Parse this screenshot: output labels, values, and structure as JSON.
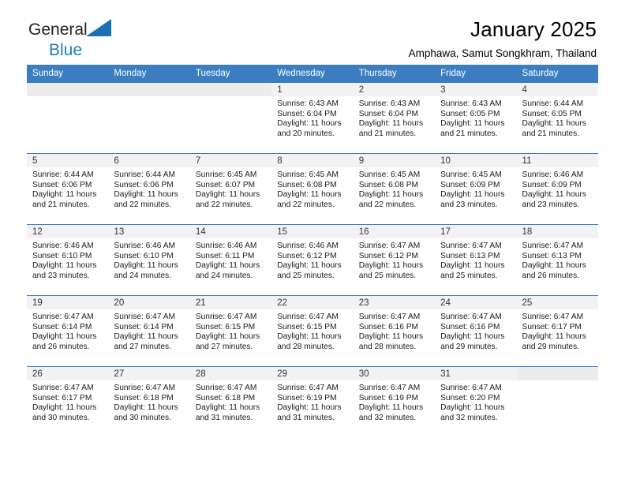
{
  "brand": {
    "name_part1": "General",
    "name_part2": "Blue",
    "accent_color": "#1a7cc6"
  },
  "header": {
    "title": "January 2025",
    "location": "Amphawa, Samut Songkhram, Thailand"
  },
  "theme": {
    "header_row_bg": "#3b7dc0",
    "daynum_band_bg": "#f2f2f2",
    "empty_band_bg": "#ececec"
  },
  "weekday_headers": [
    "Sunday",
    "Monday",
    "Tuesday",
    "Wednesday",
    "Thursday",
    "Friday",
    "Saturday"
  ],
  "weeks": [
    [
      {
        "day": "",
        "sunrise": "",
        "sunset": "",
        "daylight1": "",
        "daylight2": "",
        "empty": true
      },
      {
        "day": "",
        "sunrise": "",
        "sunset": "",
        "daylight1": "",
        "daylight2": "",
        "empty": true
      },
      {
        "day": "",
        "sunrise": "",
        "sunset": "",
        "daylight1": "",
        "daylight2": "",
        "empty": true
      },
      {
        "day": "1",
        "sunrise": "Sunrise: 6:43 AM",
        "sunset": "Sunset: 6:04 PM",
        "daylight1": "Daylight: 11 hours",
        "daylight2": "and 20 minutes.",
        "empty": false
      },
      {
        "day": "2",
        "sunrise": "Sunrise: 6:43 AM",
        "sunset": "Sunset: 6:04 PM",
        "daylight1": "Daylight: 11 hours",
        "daylight2": "and 21 minutes.",
        "empty": false
      },
      {
        "day": "3",
        "sunrise": "Sunrise: 6:43 AM",
        "sunset": "Sunset: 6:05 PM",
        "daylight1": "Daylight: 11 hours",
        "daylight2": "and 21 minutes.",
        "empty": false
      },
      {
        "day": "4",
        "sunrise": "Sunrise: 6:44 AM",
        "sunset": "Sunset: 6:05 PM",
        "daylight1": "Daylight: 11 hours",
        "daylight2": "and 21 minutes.",
        "empty": false
      }
    ],
    [
      {
        "day": "5",
        "sunrise": "Sunrise: 6:44 AM",
        "sunset": "Sunset: 6:06 PM",
        "daylight1": "Daylight: 11 hours",
        "daylight2": "and 21 minutes.",
        "empty": false
      },
      {
        "day": "6",
        "sunrise": "Sunrise: 6:44 AM",
        "sunset": "Sunset: 6:06 PM",
        "daylight1": "Daylight: 11 hours",
        "daylight2": "and 22 minutes.",
        "empty": false
      },
      {
        "day": "7",
        "sunrise": "Sunrise: 6:45 AM",
        "sunset": "Sunset: 6:07 PM",
        "daylight1": "Daylight: 11 hours",
        "daylight2": "and 22 minutes.",
        "empty": false
      },
      {
        "day": "8",
        "sunrise": "Sunrise: 6:45 AM",
        "sunset": "Sunset: 6:08 PM",
        "daylight1": "Daylight: 11 hours",
        "daylight2": "and 22 minutes.",
        "empty": false
      },
      {
        "day": "9",
        "sunrise": "Sunrise: 6:45 AM",
        "sunset": "Sunset: 6:08 PM",
        "daylight1": "Daylight: 11 hours",
        "daylight2": "and 22 minutes.",
        "empty": false
      },
      {
        "day": "10",
        "sunrise": "Sunrise: 6:45 AM",
        "sunset": "Sunset: 6:09 PM",
        "daylight1": "Daylight: 11 hours",
        "daylight2": "and 23 minutes.",
        "empty": false
      },
      {
        "day": "11",
        "sunrise": "Sunrise: 6:46 AM",
        "sunset": "Sunset: 6:09 PM",
        "daylight1": "Daylight: 11 hours",
        "daylight2": "and 23 minutes.",
        "empty": false
      }
    ],
    [
      {
        "day": "12",
        "sunrise": "Sunrise: 6:46 AM",
        "sunset": "Sunset: 6:10 PM",
        "daylight1": "Daylight: 11 hours",
        "daylight2": "and 23 minutes.",
        "empty": false
      },
      {
        "day": "13",
        "sunrise": "Sunrise: 6:46 AM",
        "sunset": "Sunset: 6:10 PM",
        "daylight1": "Daylight: 11 hours",
        "daylight2": "and 24 minutes.",
        "empty": false
      },
      {
        "day": "14",
        "sunrise": "Sunrise: 6:46 AM",
        "sunset": "Sunset: 6:11 PM",
        "daylight1": "Daylight: 11 hours",
        "daylight2": "and 24 minutes.",
        "empty": false
      },
      {
        "day": "15",
        "sunrise": "Sunrise: 6:46 AM",
        "sunset": "Sunset: 6:12 PM",
        "daylight1": "Daylight: 11 hours",
        "daylight2": "and 25 minutes.",
        "empty": false
      },
      {
        "day": "16",
        "sunrise": "Sunrise: 6:47 AM",
        "sunset": "Sunset: 6:12 PM",
        "daylight1": "Daylight: 11 hours",
        "daylight2": "and 25 minutes.",
        "empty": false
      },
      {
        "day": "17",
        "sunrise": "Sunrise: 6:47 AM",
        "sunset": "Sunset: 6:13 PM",
        "daylight1": "Daylight: 11 hours",
        "daylight2": "and 25 minutes.",
        "empty": false
      },
      {
        "day": "18",
        "sunrise": "Sunrise: 6:47 AM",
        "sunset": "Sunset: 6:13 PM",
        "daylight1": "Daylight: 11 hours",
        "daylight2": "and 26 minutes.",
        "empty": false
      }
    ],
    [
      {
        "day": "19",
        "sunrise": "Sunrise: 6:47 AM",
        "sunset": "Sunset: 6:14 PM",
        "daylight1": "Daylight: 11 hours",
        "daylight2": "and 26 minutes.",
        "empty": false
      },
      {
        "day": "20",
        "sunrise": "Sunrise: 6:47 AM",
        "sunset": "Sunset: 6:14 PM",
        "daylight1": "Daylight: 11 hours",
        "daylight2": "and 27 minutes.",
        "empty": false
      },
      {
        "day": "21",
        "sunrise": "Sunrise: 6:47 AM",
        "sunset": "Sunset: 6:15 PM",
        "daylight1": "Daylight: 11 hours",
        "daylight2": "and 27 minutes.",
        "empty": false
      },
      {
        "day": "22",
        "sunrise": "Sunrise: 6:47 AM",
        "sunset": "Sunset: 6:15 PM",
        "daylight1": "Daylight: 11 hours",
        "daylight2": "and 28 minutes.",
        "empty": false
      },
      {
        "day": "23",
        "sunrise": "Sunrise: 6:47 AM",
        "sunset": "Sunset: 6:16 PM",
        "daylight1": "Daylight: 11 hours",
        "daylight2": "and 28 minutes.",
        "empty": false
      },
      {
        "day": "24",
        "sunrise": "Sunrise: 6:47 AM",
        "sunset": "Sunset: 6:16 PM",
        "daylight1": "Daylight: 11 hours",
        "daylight2": "and 29 minutes.",
        "empty": false
      },
      {
        "day": "25",
        "sunrise": "Sunrise: 6:47 AM",
        "sunset": "Sunset: 6:17 PM",
        "daylight1": "Daylight: 11 hours",
        "daylight2": "and 29 minutes.",
        "empty": false
      }
    ],
    [
      {
        "day": "26",
        "sunrise": "Sunrise: 6:47 AM",
        "sunset": "Sunset: 6:17 PM",
        "daylight1": "Daylight: 11 hours",
        "daylight2": "and 30 minutes.",
        "empty": false
      },
      {
        "day": "27",
        "sunrise": "Sunrise: 6:47 AM",
        "sunset": "Sunset: 6:18 PM",
        "daylight1": "Daylight: 11 hours",
        "daylight2": "and 30 minutes.",
        "empty": false
      },
      {
        "day": "28",
        "sunrise": "Sunrise: 6:47 AM",
        "sunset": "Sunset: 6:18 PM",
        "daylight1": "Daylight: 11 hours",
        "daylight2": "and 31 minutes.",
        "empty": false
      },
      {
        "day": "29",
        "sunrise": "Sunrise: 6:47 AM",
        "sunset": "Sunset: 6:19 PM",
        "daylight1": "Daylight: 11 hours",
        "daylight2": "and 31 minutes.",
        "empty": false
      },
      {
        "day": "30",
        "sunrise": "Sunrise: 6:47 AM",
        "sunset": "Sunset: 6:19 PM",
        "daylight1": "Daylight: 11 hours",
        "daylight2": "and 32 minutes.",
        "empty": false
      },
      {
        "day": "31",
        "sunrise": "Sunrise: 6:47 AM",
        "sunset": "Sunset: 6:20 PM",
        "daylight1": "Daylight: 11 hours",
        "daylight2": "and 32 minutes.",
        "empty": false
      },
      {
        "day": "",
        "sunrise": "",
        "sunset": "",
        "daylight1": "",
        "daylight2": "",
        "empty": true
      }
    ]
  ]
}
